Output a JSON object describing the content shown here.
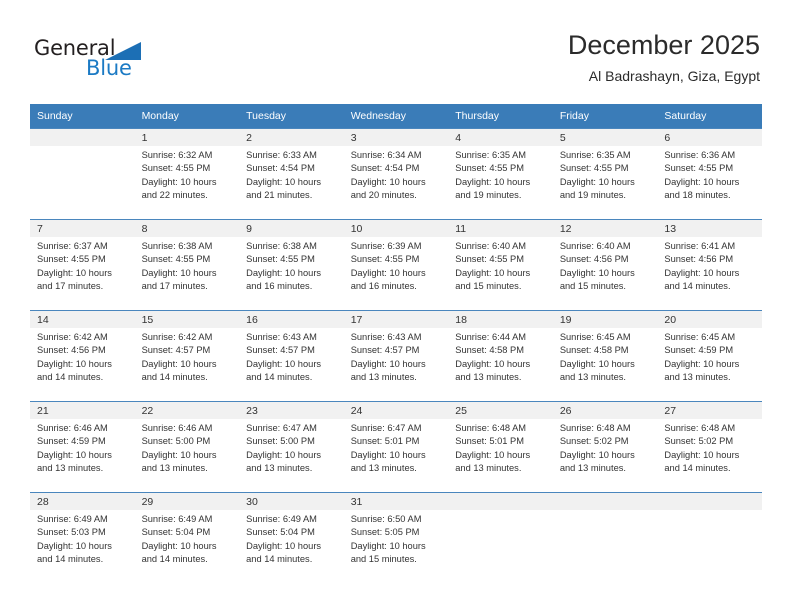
{
  "brand": {
    "name_top": "General",
    "name_bottom": "Blue",
    "triangle_color": "#1c6fb5",
    "blue_text_color": "#1b7ac4"
  },
  "header": {
    "title": "December 2025",
    "subtitle": "Al Badrashayn, Giza, Egypt"
  },
  "theme": {
    "header_row_bg": "#3a7cb8",
    "header_row_text": "#ffffff",
    "daynum_band_bg": "#f1f1f1",
    "row_divider": "#4a86bd",
    "body_text": "#333333"
  },
  "weekdays": [
    "Sunday",
    "Monday",
    "Tuesday",
    "Wednesday",
    "Thursday",
    "Friday",
    "Saturday"
  ],
  "labels": {
    "sunrise_prefix": "Sunrise:",
    "sunset_prefix": "Sunset:",
    "daylight_prefix": "Daylight:"
  },
  "weeks": [
    [
      {
        "day": "",
        "empty": true
      },
      {
        "day": "1",
        "sunrise": "Sunrise: 6:32 AM",
        "sunset": "Sunset: 4:55 PM",
        "daylight_line1": "Daylight: 10 hours",
        "daylight_line2": "and 22 minutes."
      },
      {
        "day": "2",
        "sunrise": "Sunrise: 6:33 AM",
        "sunset": "Sunset: 4:54 PM",
        "daylight_line1": "Daylight: 10 hours",
        "daylight_line2": "and 21 minutes."
      },
      {
        "day": "3",
        "sunrise": "Sunrise: 6:34 AM",
        "sunset": "Sunset: 4:54 PM",
        "daylight_line1": "Daylight: 10 hours",
        "daylight_line2": "and 20 minutes."
      },
      {
        "day": "4",
        "sunrise": "Sunrise: 6:35 AM",
        "sunset": "Sunset: 4:55 PM",
        "daylight_line1": "Daylight: 10 hours",
        "daylight_line2": "and 19 minutes."
      },
      {
        "day": "5",
        "sunrise": "Sunrise: 6:35 AM",
        "sunset": "Sunset: 4:55 PM",
        "daylight_line1": "Daylight: 10 hours",
        "daylight_line2": "and 19 minutes."
      },
      {
        "day": "6",
        "sunrise": "Sunrise: 6:36 AM",
        "sunset": "Sunset: 4:55 PM",
        "daylight_line1": "Daylight: 10 hours",
        "daylight_line2": "and 18 minutes."
      }
    ],
    [
      {
        "day": "7",
        "sunrise": "Sunrise: 6:37 AM",
        "sunset": "Sunset: 4:55 PM",
        "daylight_line1": "Daylight: 10 hours",
        "daylight_line2": "and 17 minutes."
      },
      {
        "day": "8",
        "sunrise": "Sunrise: 6:38 AM",
        "sunset": "Sunset: 4:55 PM",
        "daylight_line1": "Daylight: 10 hours",
        "daylight_line2": "and 17 minutes."
      },
      {
        "day": "9",
        "sunrise": "Sunrise: 6:38 AM",
        "sunset": "Sunset: 4:55 PM",
        "daylight_line1": "Daylight: 10 hours",
        "daylight_line2": "and 16 minutes."
      },
      {
        "day": "10",
        "sunrise": "Sunrise: 6:39 AM",
        "sunset": "Sunset: 4:55 PM",
        "daylight_line1": "Daylight: 10 hours",
        "daylight_line2": "and 16 minutes."
      },
      {
        "day": "11",
        "sunrise": "Sunrise: 6:40 AM",
        "sunset": "Sunset: 4:55 PM",
        "daylight_line1": "Daylight: 10 hours",
        "daylight_line2": "and 15 minutes."
      },
      {
        "day": "12",
        "sunrise": "Sunrise: 6:40 AM",
        "sunset": "Sunset: 4:56 PM",
        "daylight_line1": "Daylight: 10 hours",
        "daylight_line2": "and 15 minutes."
      },
      {
        "day": "13",
        "sunrise": "Sunrise: 6:41 AM",
        "sunset": "Sunset: 4:56 PM",
        "daylight_line1": "Daylight: 10 hours",
        "daylight_line2": "and 14 minutes."
      }
    ],
    [
      {
        "day": "14",
        "sunrise": "Sunrise: 6:42 AM",
        "sunset": "Sunset: 4:56 PM",
        "daylight_line1": "Daylight: 10 hours",
        "daylight_line2": "and 14 minutes."
      },
      {
        "day": "15",
        "sunrise": "Sunrise: 6:42 AM",
        "sunset": "Sunset: 4:57 PM",
        "daylight_line1": "Daylight: 10 hours",
        "daylight_line2": "and 14 minutes."
      },
      {
        "day": "16",
        "sunrise": "Sunrise: 6:43 AM",
        "sunset": "Sunset: 4:57 PM",
        "daylight_line1": "Daylight: 10 hours",
        "daylight_line2": "and 14 minutes."
      },
      {
        "day": "17",
        "sunrise": "Sunrise: 6:43 AM",
        "sunset": "Sunset: 4:57 PM",
        "daylight_line1": "Daylight: 10 hours",
        "daylight_line2": "and 13 minutes."
      },
      {
        "day": "18",
        "sunrise": "Sunrise: 6:44 AM",
        "sunset": "Sunset: 4:58 PM",
        "daylight_line1": "Daylight: 10 hours",
        "daylight_line2": "and 13 minutes."
      },
      {
        "day": "19",
        "sunrise": "Sunrise: 6:45 AM",
        "sunset": "Sunset: 4:58 PM",
        "daylight_line1": "Daylight: 10 hours",
        "daylight_line2": "and 13 minutes."
      },
      {
        "day": "20",
        "sunrise": "Sunrise: 6:45 AM",
        "sunset": "Sunset: 4:59 PM",
        "daylight_line1": "Daylight: 10 hours",
        "daylight_line2": "and 13 minutes."
      }
    ],
    [
      {
        "day": "21",
        "sunrise": "Sunrise: 6:46 AM",
        "sunset": "Sunset: 4:59 PM",
        "daylight_line1": "Daylight: 10 hours",
        "daylight_line2": "and 13 minutes."
      },
      {
        "day": "22",
        "sunrise": "Sunrise: 6:46 AM",
        "sunset": "Sunset: 5:00 PM",
        "daylight_line1": "Daylight: 10 hours",
        "daylight_line2": "and 13 minutes."
      },
      {
        "day": "23",
        "sunrise": "Sunrise: 6:47 AM",
        "sunset": "Sunset: 5:00 PM",
        "daylight_line1": "Daylight: 10 hours",
        "daylight_line2": "and 13 minutes."
      },
      {
        "day": "24",
        "sunrise": "Sunrise: 6:47 AM",
        "sunset": "Sunset: 5:01 PM",
        "daylight_line1": "Daylight: 10 hours",
        "daylight_line2": "and 13 minutes."
      },
      {
        "day": "25",
        "sunrise": "Sunrise: 6:48 AM",
        "sunset": "Sunset: 5:01 PM",
        "daylight_line1": "Daylight: 10 hours",
        "daylight_line2": "and 13 minutes."
      },
      {
        "day": "26",
        "sunrise": "Sunrise: 6:48 AM",
        "sunset": "Sunset: 5:02 PM",
        "daylight_line1": "Daylight: 10 hours",
        "daylight_line2": "and 13 minutes."
      },
      {
        "day": "27",
        "sunrise": "Sunrise: 6:48 AM",
        "sunset": "Sunset: 5:02 PM",
        "daylight_line1": "Daylight: 10 hours",
        "daylight_line2": "and 14 minutes."
      }
    ],
    [
      {
        "day": "28",
        "sunrise": "Sunrise: 6:49 AM",
        "sunset": "Sunset: 5:03 PM",
        "daylight_line1": "Daylight: 10 hours",
        "daylight_line2": "and 14 minutes."
      },
      {
        "day": "29",
        "sunrise": "Sunrise: 6:49 AM",
        "sunset": "Sunset: 5:04 PM",
        "daylight_line1": "Daylight: 10 hours",
        "daylight_line2": "and 14 minutes."
      },
      {
        "day": "30",
        "sunrise": "Sunrise: 6:49 AM",
        "sunset": "Sunset: 5:04 PM",
        "daylight_line1": "Daylight: 10 hours",
        "daylight_line2": "and 14 minutes."
      },
      {
        "day": "31",
        "sunrise": "Sunrise: 6:50 AM",
        "sunset": "Sunset: 5:05 PM",
        "daylight_line1": "Daylight: 10 hours",
        "daylight_line2": "and 15 minutes."
      },
      {
        "day": "",
        "empty": true
      },
      {
        "day": "",
        "empty": true
      },
      {
        "day": "",
        "empty": true
      }
    ]
  ]
}
